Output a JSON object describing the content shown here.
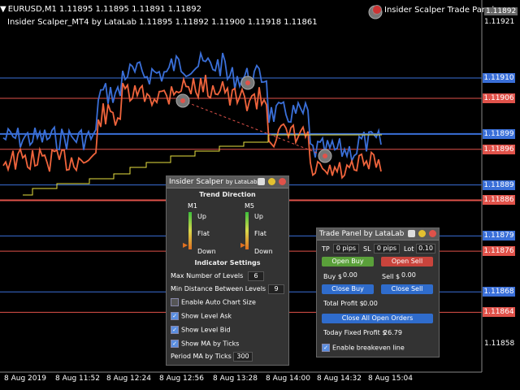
{
  "window": {
    "symbol_line": "EURUSD,M1  1.11895 1.11895 1.11891 1.11892",
    "indicator_line": "Insider Scalper_MT4 by LataLab 1.11895 1.11892 1.11900 1.11918 1.11861",
    "tab_label": "Insider Scalper Trade Panel"
  },
  "price_axis": {
    "top_prices": [
      "1.11892",
      "1.11921"
    ],
    "bottom_price": "1.11858",
    "levels": [
      {
        "price": "1.11910",
        "color": "#3a6fd8"
      },
      {
        "price": "1.11906",
        "color": "#e0524a"
      },
      {
        "price": "1.11899",
        "color": "#3a6fd8"
      },
      {
        "price": "1.11896",
        "color": "#e0524a"
      },
      {
        "price": "1.11889",
        "color": "#3a6fd8"
      },
      {
        "price": "1.11886",
        "color": "#e0524a"
      },
      {
        "price": "1.11879",
        "color": "#3a6fd8"
      },
      {
        "price": "1.11876",
        "color": "#e0524a"
      },
      {
        "price": "1.11868",
        "color": "#3a6fd8"
      },
      {
        "price": "1.11864",
        "color": "#e0524a"
      }
    ]
  },
  "time_axis": [
    "8 Aug 2019",
    "8 Aug 11:52",
    "8 Aug 12:24",
    "8 Aug 12:56",
    "8 Aug 13:28",
    "8 Aug 14:00",
    "8 Aug 14:32",
    "8 Aug 15:04"
  ],
  "indicator_panel": {
    "title": "Insider Scalper",
    "title_by": "by LataLab",
    "trend_title": "Trend Direction",
    "m1": "M1",
    "m5": "M5",
    "up": "Up",
    "flat": "Flat",
    "down": "Down",
    "settings_title": "Indicator Settings",
    "max_levels_label": "Max Number of Levels",
    "max_levels_value": "6",
    "min_distance_label": "Min Distance Between Levels",
    "min_distance_value": "9",
    "auto_chart_label": "Enable Auto Chart Size",
    "show_ask_label": "Show Level Ask",
    "show_bid_label": "Show Level Bid",
    "show_ma_label": "Show MA by Ticks",
    "period_ma_label": "Period MA by Ticks",
    "period_ma_value": "300"
  },
  "trade_panel": {
    "title": "Trade Panel by LataLab",
    "tp_label": "TP",
    "tp_value": "0 pips",
    "sl_label": "SL",
    "sl_value": "0 pips",
    "lot_label": "Lot",
    "lot_value": "0.10",
    "open_buy": "Open Buy",
    "open_sell": "Open Sell",
    "buy_label": "Buy $",
    "buy_value": "0.00",
    "sell_label": "Sell $",
    "sell_value": "0.00",
    "close_buy": "Close Buy",
    "close_sell": "Close Sell",
    "total_profit_label": "Total Profit $",
    "total_profit_value": "0.00",
    "close_all": "Close All Open Orders",
    "today_profit_label": "Today Fixed Profit $",
    "today_profit_value": "26.79",
    "breakeven_label": "Enable breakeven line"
  }
}
